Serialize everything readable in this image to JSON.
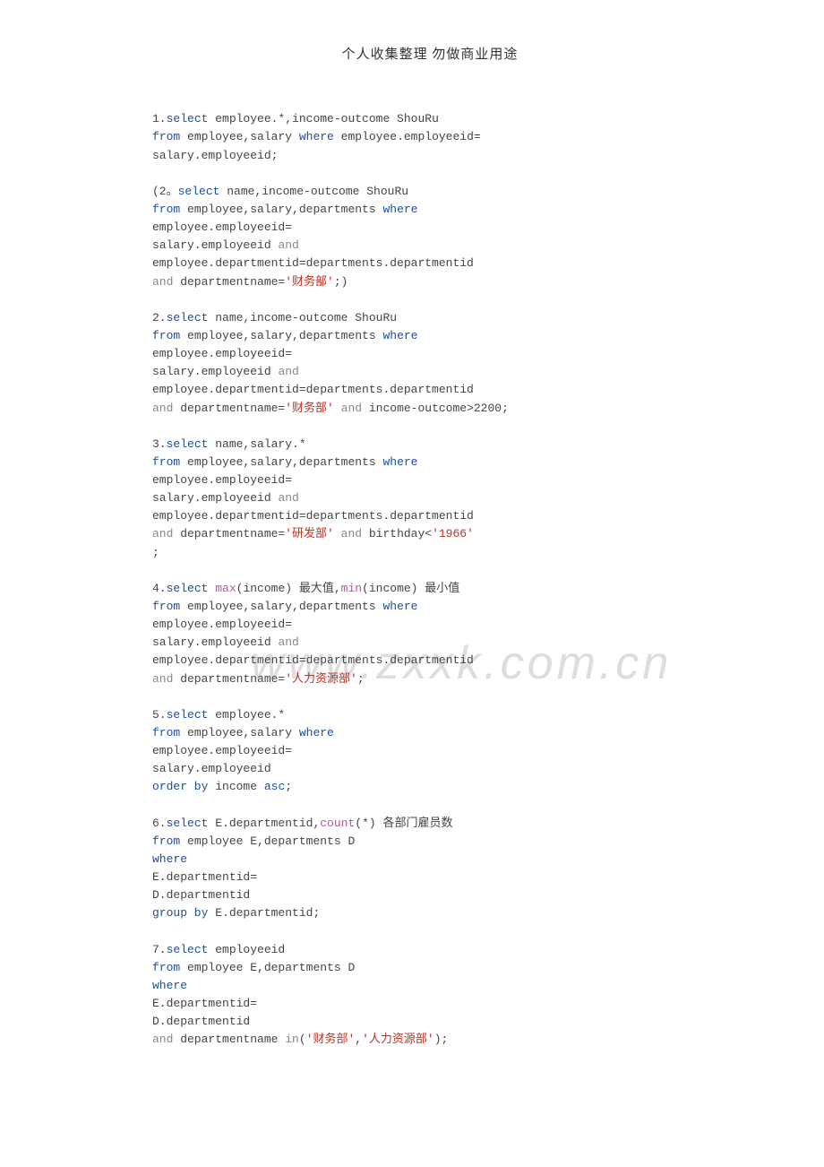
{
  "header": "个人收集整理 勿做商业用途",
  "watermark": "www.zxxk.com.cn",
  "queries": {
    "q1_l1_a": "1.",
    "q1_l1_b": "select",
    "q1_l1_c": " employee.*,income-outcome ShouRu",
    "q1_l2_a": "from",
    "q1_l2_b": " employee,salary ",
    "q1_l2_c": "where",
    "q1_l2_d": " employee.employeeid=",
    "q1_l3": "salary.employeeid;",
    "q2a_l1_a": "(2。",
    "q2a_l1_b": "select",
    "q2a_l1_c": " name,income-outcome ShouRu",
    "q2a_l2_a": "from",
    "q2a_l2_b": " employee,salary,departments ",
    "q2a_l2_c": "where",
    "q2a_l3": "employee.employeeid=",
    "q2a_l4_a": "salary.employeeid ",
    "q2a_l4_b": "and",
    "q2a_l5": "employee.departmentid=departments.departmentid",
    "q2a_l6_a": "and",
    "q2a_l6_b": " departmentname=",
    "q2a_l6_c": "'财务部'",
    "q2a_l6_d": ";)",
    "q2_l1_a": "2.",
    "q2_l1_b": "select",
    "q2_l1_c": " name,income-outcome ShouRu",
    "q2_l2_a": "from",
    "q2_l2_b": " employee,salary,departments ",
    "q2_l2_c": "where",
    "q2_l3": "employee.employeeid=",
    "q2_l4_a": "salary.employeeid ",
    "q2_l4_b": "and",
    "q2_l5": "employee.departmentid=departments.departmentid",
    "q2_l6_a": "and",
    "q2_l6_b": " departmentname=",
    "q2_l6_c": "'财务部'",
    "q2_l6_d": " ",
    "q2_l6_e": "and",
    "q2_l6_f": " income-outcome>2200;",
    "q3_l1_a": "3.",
    "q3_l1_b": "select",
    "q3_l1_c": " name,salary.*",
    "q3_l2_a": "from",
    "q3_l2_b": " employee,salary,departments ",
    "q3_l2_c": "where",
    "q3_l3": "employee.employeeid=",
    "q3_l4_a": "salary.employeeid ",
    "q3_l4_b": "and",
    "q3_l5": "employee.departmentid=departments.departmentid",
    "q3_l6_a": "and",
    "q3_l6_b": " departmentname=",
    "q3_l6_c": "'研发部'",
    "q3_l6_d": " ",
    "q3_l6_e": "and",
    "q3_l6_f": " birthday<",
    "q3_l6_g": "'1966'",
    "q3_l7": ";",
    "q4_l1_a": "4.",
    "q4_l1_b": "select",
    "q4_l1_c": " ",
    "q4_l1_d": "max",
    "q4_l1_e": "(income) 最大值,",
    "q4_l1_f": "min",
    "q4_l1_g": "(income) 最小值",
    "q4_l2_a": "from",
    "q4_l2_b": " employee,salary,departments ",
    "q4_l2_c": "where",
    "q4_l3": "employee.employeeid=",
    "q4_l4_a": "salary.employeeid ",
    "q4_l4_b": "and",
    "q4_l5": "employee.departmentid=departments.departmentid",
    "q4_l6_a": "and",
    "q4_l6_b": " departmentname=",
    "q4_l6_c": "'人力资源部'",
    "q4_l6_d": ";",
    "q5_l1_a": "5.",
    "q5_l1_b": "select",
    "q5_l1_c": " employee.*",
    "q5_l2_a": "from",
    "q5_l2_b": " employee,salary ",
    "q5_l2_c": "where",
    "q5_l3": "employee.employeeid=",
    "q5_l4": "salary.employeeid",
    "q5_l5_a": "order by",
    "q5_l5_b": " income ",
    "q5_l5_c": "asc",
    "q5_l5_d": ";",
    "q6_l1_a": "6.",
    "q6_l1_b": "select",
    "q6_l1_c": " E.departmentid,",
    "q6_l1_d": "count",
    "q6_l1_e": "(*) 各部门雇员数",
    "q6_l2_a": "from",
    "q6_l2_b": " employee E,departments D",
    "q6_l3": "where",
    "q6_l4": "E.departmentid=",
    "q6_l5": "D.departmentid",
    "q6_l6_a": "group by",
    "q6_l6_b": " E.departmentid;",
    "q7_l1_a": "7.",
    "q7_l1_b": "select",
    "q7_l1_c": " employeeid",
    "q7_l2_a": "from",
    "q7_l2_b": " employee E,departments D",
    "q7_l3": "where",
    "q7_l4": "E.departmentid=",
    "q7_l5": "D.departmentid",
    "q7_l6_a": "and",
    "q7_l6_b": " departmentname ",
    "q7_l6_c": "in",
    "q7_l6_d": "(",
    "q7_l6_e": "'财务部'",
    "q7_l6_f": ",",
    "q7_l6_g": "'人力资源部'",
    "q7_l6_h": ");"
  }
}
